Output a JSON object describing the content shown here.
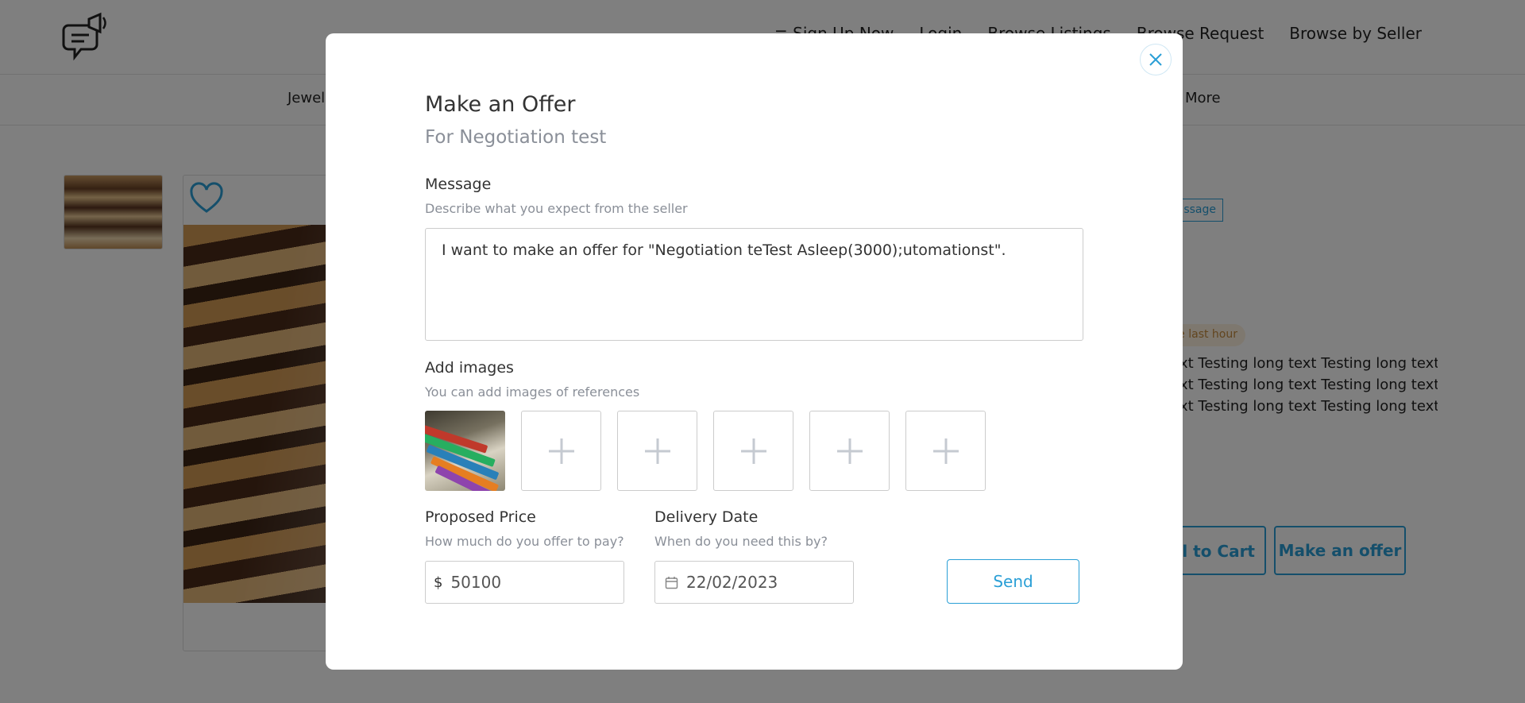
{
  "header": {
    "nav": [
      "≡ Sign Up Now",
      "Login",
      "Browse Listings",
      "Browse Request",
      "Browse by Seller"
    ],
    "categories_first": "Jewelr",
    "categories_more": "More"
  },
  "product": {
    "tag_message": "ssage",
    "tag_hour": "e last hour",
    "long_text": [
      "g text Testing long text Testing long text",
      "g text Testing long text Testing long text",
      "g text Testing long text Testing long text"
    ],
    "add_to_cart_label": "l to Cart",
    "make_offer_label": "Make an offer"
  },
  "modal": {
    "title": "Make an Offer",
    "subtitle": "For Negotiation test",
    "message": {
      "label": "Message",
      "hint": "Describe what you expect from the seller",
      "value": "I want to make an offer for \"Negotiation teTest Asleep(3000);utomationst\"."
    },
    "images": {
      "label": "Add images",
      "hint": "You can add images of references",
      "empty_slot_glyph": "+"
    },
    "price": {
      "label": "Proposed Price",
      "hint": "How much do you offer to pay?",
      "currency": "$",
      "value": "50100"
    },
    "delivery": {
      "label": "Delivery Date",
      "hint": "When do you need this by?",
      "value": "22/02/2023"
    },
    "send_label": "Send"
  },
  "colors": {
    "accent": "#2a9fd6",
    "overlay": "rgba(0,0,0,0.5)",
    "muted_text": "#8a8f98"
  },
  "icons": {
    "logo": "chat-megaphone-icon",
    "heart": "heart-icon",
    "close": "close-icon",
    "calendar": "calendar-icon",
    "plus": "plus-icon"
  }
}
